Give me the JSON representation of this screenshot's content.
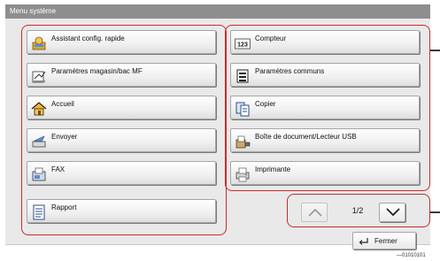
{
  "window": {
    "title": "Menu système"
  },
  "left_column": [
    {
      "label": "Assistant config. rapide",
      "icon": "quick-setup-icon"
    },
    {
      "label": "Paramètres magasin/bac MF",
      "icon": "paper-tray-icon"
    },
    {
      "label": "Accueil",
      "icon": "home-icon"
    },
    {
      "label": "Envoyer",
      "icon": "send-icon"
    },
    {
      "label": "FAX",
      "icon": "fax-icon"
    },
    {
      "label": "Rapport",
      "icon": "report-icon"
    }
  ],
  "right_column": [
    {
      "label": "Compteur",
      "icon": "counter-icon",
      "icon_text": "123"
    },
    {
      "label": "Paramètres communs",
      "icon": "common-settings-icon"
    },
    {
      "label": "Copier",
      "icon": "copy-icon"
    },
    {
      "label": "Boîte de document/Lecteur USB",
      "icon": "document-box-icon"
    },
    {
      "label": "Imprimante",
      "icon": "printer-icon"
    }
  ],
  "pager": {
    "text": "1/2"
  },
  "close": {
    "label": "Fermer"
  },
  "figure_ref": "—01010101",
  "colors": {
    "highlight": "#cc2a2a",
    "titlebar": "#8e8e8e",
    "panel": "#e9e9e9"
  }
}
